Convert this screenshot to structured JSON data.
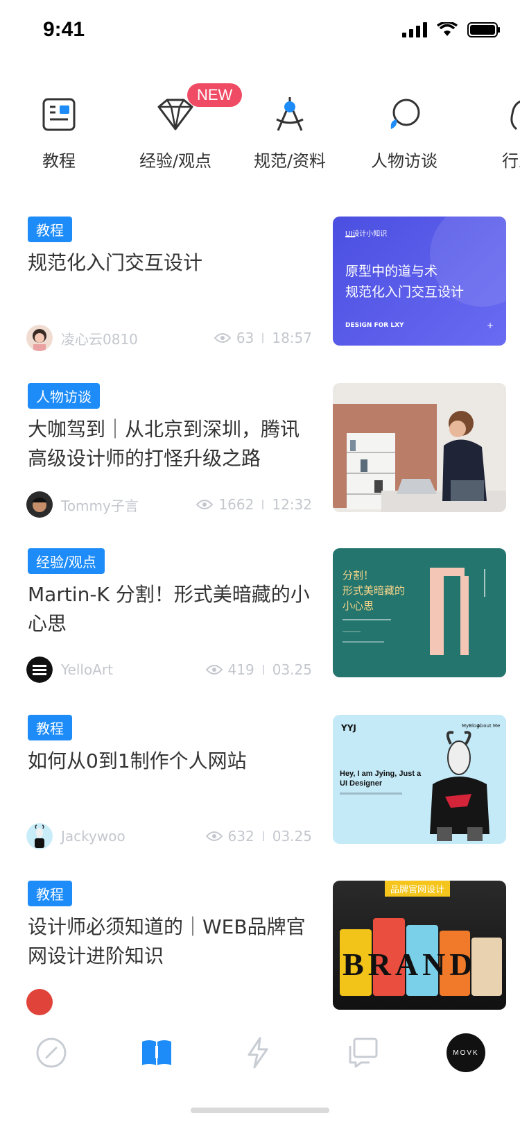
{
  "status": {
    "time": "9:41"
  },
  "categories": [
    {
      "label": "教程",
      "icon": "tutorial-icon"
    },
    {
      "label": "经验/观点",
      "icon": "diamond-icon",
      "badge": "NEW"
    },
    {
      "label": "规范/资料",
      "icon": "compass-icon"
    },
    {
      "label": "人物访谈",
      "icon": "chat-bubble-icon"
    },
    {
      "label": "行业",
      "icon": "industry-icon"
    }
  ],
  "articles": [
    {
      "tag": "教程",
      "title": "规范化入门交互设计",
      "author": "凌心云0810",
      "views": "63",
      "time": "18:57",
      "thumb": {
        "kicker": "UI设计小知识",
        "headline1": "原型中的道与术",
        "headline2": "规范化入门交互设计",
        "footer": "DESIGN FOR LXY"
      }
    },
    {
      "tag": "人物访谈",
      "title": "大咖驾到｜从北京到深圳，腾讯高级设计师的打怪升级之路",
      "author": "Tommy子言",
      "views": "1662",
      "time": "12:32"
    },
    {
      "tag": "经验/观点",
      "title": "Martin-K 分割！形式美暗藏的小心思",
      "author": "YelloArt",
      "views": "419",
      "time": "03.25",
      "thumb": {
        "line1": "分割！",
        "line2": "形式美暗藏的",
        "line3": "小心思"
      }
    },
    {
      "tag": "教程",
      "title": "如何从0到1制作个人网站",
      "author": "Jackywoo",
      "views": "632",
      "time": "03.25",
      "thumb": {
        "nav1": "MyBlog",
        "nav2": "About Me",
        "hero": "Hey, I am Jying, Just a UI Designer"
      }
    },
    {
      "tag": "教程",
      "title": "设计师必须知道的｜WEB品牌官网设计进阶知识",
      "author": "",
      "views": "",
      "time": "",
      "thumb": {
        "banner": "品牌官网设计",
        "word": "BRAND"
      }
    }
  ],
  "tabbar": [
    {
      "icon": "compass-nav-icon",
      "active": false
    },
    {
      "icon": "book-icon",
      "active": true
    },
    {
      "icon": "lightning-icon",
      "active": false
    },
    {
      "icon": "messages-icon",
      "active": false
    },
    {
      "icon": "profile-avatar-icon",
      "label": "MOVK",
      "active": false
    }
  ],
  "colors": {
    "accent": "#1d8cf8",
    "badge": "#ef4b64",
    "meta": "#c3c7cd"
  }
}
